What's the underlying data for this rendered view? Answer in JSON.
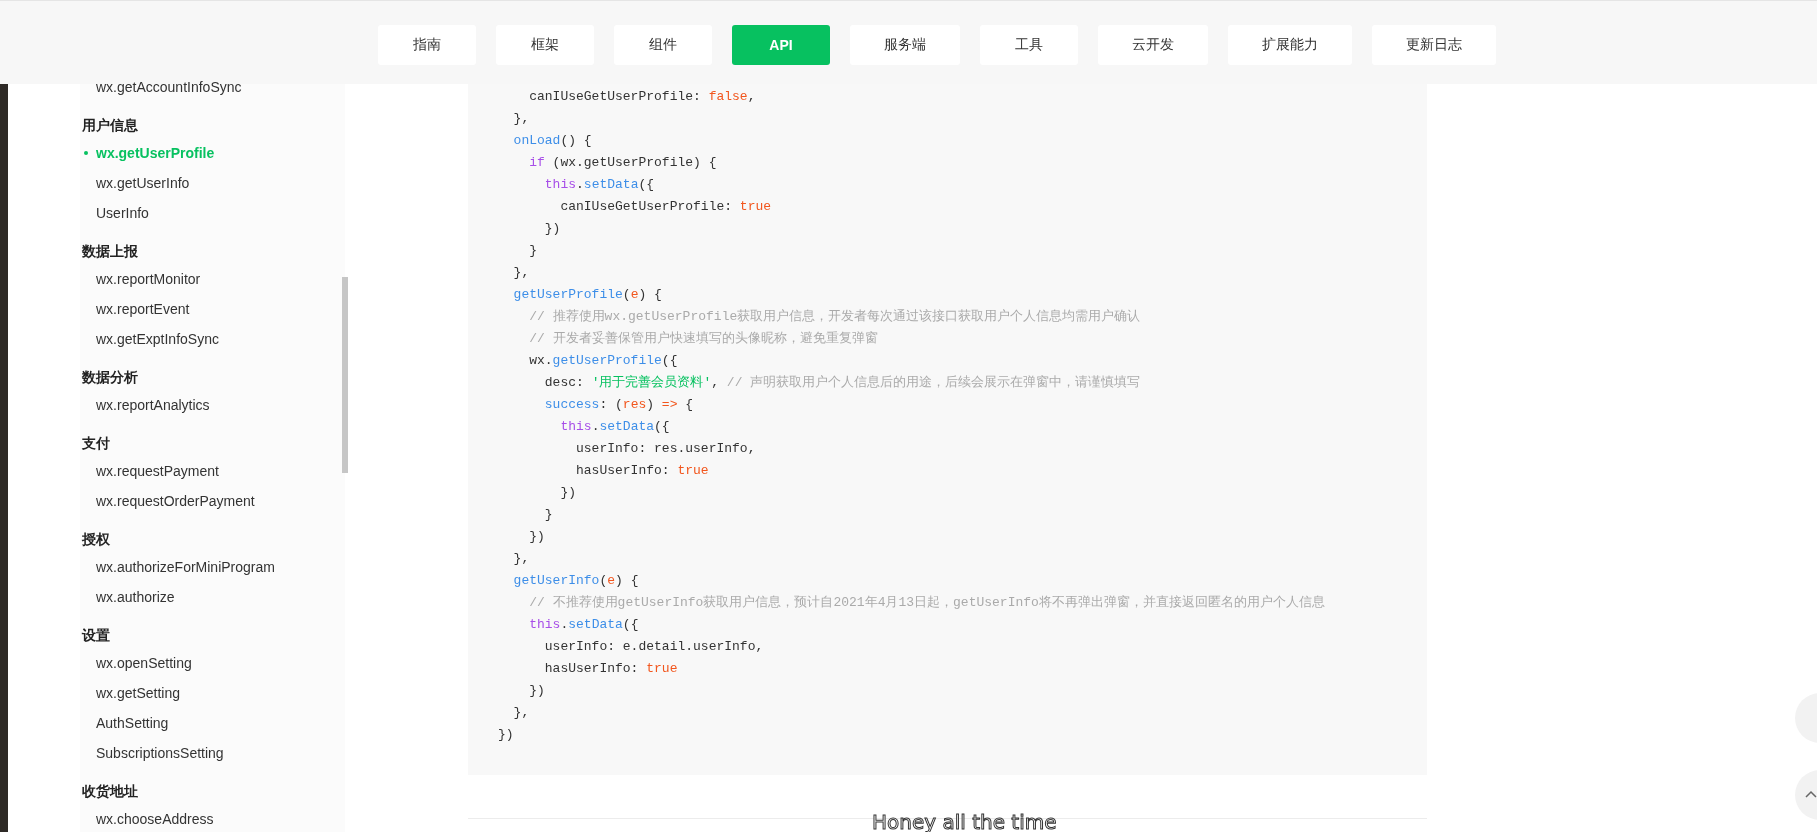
{
  "nav": {
    "tabs": [
      {
        "label": "指南",
        "selected": false
      },
      {
        "label": "框架",
        "selected": false
      },
      {
        "label": "组件",
        "selected": false
      },
      {
        "label": "API",
        "selected": true
      },
      {
        "label": "服务端",
        "selected": false
      },
      {
        "label": "工具",
        "selected": false
      },
      {
        "label": "云开发",
        "selected": false
      },
      {
        "label": "扩展能力",
        "selected": false
      },
      {
        "label": "更新日志",
        "selected": false
      }
    ]
  },
  "sidebar": {
    "groups": [
      {
        "items": [
          {
            "label": "wx.getAccountInfoSync",
            "selected": false
          }
        ]
      },
      {
        "heading": "用户信息",
        "items": [
          {
            "label": "wx.getUserProfile",
            "selected": true
          },
          {
            "label": "wx.getUserInfo",
            "selected": false
          },
          {
            "label": "UserInfo",
            "selected": false
          }
        ]
      },
      {
        "heading": "数据上报",
        "items": [
          {
            "label": "wx.reportMonitor",
            "selected": false
          },
          {
            "label": "wx.reportEvent",
            "selected": false
          },
          {
            "label": "wx.getExptInfoSync",
            "selected": false
          }
        ]
      },
      {
        "heading": "数据分析",
        "items": [
          {
            "label": "wx.reportAnalytics",
            "selected": false
          }
        ]
      },
      {
        "heading": "支付",
        "items": [
          {
            "label": "wx.requestPayment",
            "selected": false
          },
          {
            "label": "wx.requestOrderPayment",
            "selected": false
          }
        ]
      },
      {
        "heading": "授权",
        "items": [
          {
            "label": "wx.authorizeForMiniProgram",
            "selected": false
          },
          {
            "label": "wx.authorize",
            "selected": false
          }
        ]
      },
      {
        "heading": "设置",
        "items": [
          {
            "label": "wx.openSetting",
            "selected": false
          },
          {
            "label": "wx.getSetting",
            "selected": false
          },
          {
            "label": "AuthSetting",
            "selected": false
          },
          {
            "label": "SubscriptionsSetting",
            "selected": false
          }
        ]
      },
      {
        "heading": "收货地址",
        "items": [
          {
            "label": "wx.chooseAddress",
            "selected": false
          }
        ]
      }
    ]
  },
  "code": {
    "lines": [
      [
        {
          "t": "    canIUseGetUserProfile: ",
          "kind": "plain"
        },
        {
          "t": "false",
          "kind": "literal"
        },
        {
          "t": ",",
          "kind": "plain"
        }
      ],
      [
        {
          "t": "  },",
          "kind": "plain"
        }
      ],
      [
        {
          "t": "  onLoad",
          "kind": "function"
        },
        {
          "t": "() {",
          "kind": "plain"
        }
      ],
      [
        {
          "t": "    if",
          "kind": "keyword"
        },
        {
          "t": " (wx.getUserProfile) {",
          "kind": "plain"
        }
      ],
      [
        {
          "t": "      this",
          "kind": "keyword"
        },
        {
          "t": ".",
          "kind": "plain"
        },
        {
          "t": "setData",
          "kind": "function"
        },
        {
          "t": "({",
          "kind": "plain"
        }
      ],
      [
        {
          "t": "        canIUseGetUserProfile: ",
          "kind": "plain"
        },
        {
          "t": "true",
          "kind": "literal"
        }
      ],
      [
        {
          "t": "      })",
          "kind": "plain"
        }
      ],
      [
        {
          "t": "    }",
          "kind": "plain"
        }
      ],
      [
        {
          "t": "  },",
          "kind": "plain"
        }
      ],
      [
        {
          "t": "  getUserProfile",
          "kind": "function"
        },
        {
          "t": "(",
          "kind": "plain"
        },
        {
          "t": "e",
          "kind": "literal"
        },
        {
          "t": ") {",
          "kind": "plain"
        }
      ],
      [
        {
          "t": "    // 推荐使用",
          "kind": "comment"
        },
        {
          "t": "wx.getUserProfile",
          "kind": "comment_code"
        },
        {
          "t": "获取用户信息，开发者每次通过该接口获取用户个人信息均需用户确认",
          "kind": "comment"
        }
      ],
      [
        {
          "t": "    // 开发者妥善保管用户快速填写的头像昵称，避免重复弹窗",
          "kind": "comment"
        }
      ],
      [
        {
          "t": "    wx.",
          "kind": "plain"
        },
        {
          "t": "getUserProfile",
          "kind": "function"
        },
        {
          "t": "({",
          "kind": "plain"
        }
      ],
      [
        {
          "t": "      desc: ",
          "kind": "plain"
        },
        {
          "t": "'用于完善会员资料'",
          "kind": "string"
        },
        {
          "t": ", ",
          "kind": "plain"
        },
        {
          "t": "// 声明获取用户个人信息后的用途，后续会展示在弹窗中，请谨慎填写",
          "kind": "comment"
        }
      ],
      [
        {
          "t": "      success",
          "kind": "function"
        },
        {
          "t": ": (",
          "kind": "plain"
        },
        {
          "t": "res",
          "kind": "literal"
        },
        {
          "t": ") ",
          "kind": "plain"
        },
        {
          "t": "=>",
          "kind": "literal"
        },
        {
          "t": " {",
          "kind": "plain"
        }
      ],
      [
        {
          "t": "        this",
          "kind": "keyword"
        },
        {
          "t": ".",
          "kind": "plain"
        },
        {
          "t": "setData",
          "kind": "function"
        },
        {
          "t": "({",
          "kind": "plain"
        }
      ],
      [
        {
          "t": "          userInfo: res.userInfo,",
          "kind": "plain"
        }
      ],
      [
        {
          "t": "          hasUserInfo: ",
          "kind": "plain"
        },
        {
          "t": "true",
          "kind": "literal"
        }
      ],
      [
        {
          "t": "        })",
          "kind": "plain"
        }
      ],
      [
        {
          "t": "      }",
          "kind": "plain"
        }
      ],
      [
        {
          "t": "    })",
          "kind": "plain"
        }
      ],
      [
        {
          "t": "  },",
          "kind": "plain"
        }
      ],
      [
        {
          "t": "  getUserInfo",
          "kind": "function"
        },
        {
          "t": "(",
          "kind": "plain"
        },
        {
          "t": "e",
          "kind": "literal"
        },
        {
          "t": ") {",
          "kind": "plain"
        }
      ],
      [
        {
          "t": "    // 不推荐使用",
          "kind": "comment"
        },
        {
          "t": "getUserInfo",
          "kind": "comment_code"
        },
        {
          "t": "获取用户信息，预计自2021年4月13日起，",
          "kind": "comment"
        },
        {
          "t": "getUserInfo",
          "kind": "comment_code"
        },
        {
          "t": "将不再弹出弹窗，并直接返回匿名的用户个人信息",
          "kind": "comment"
        }
      ],
      [
        {
          "t": "    this",
          "kind": "keyword"
        },
        {
          "t": ".",
          "kind": "plain"
        },
        {
          "t": "setData",
          "kind": "function"
        },
        {
          "t": "({",
          "kind": "plain"
        }
      ],
      [
        {
          "t": "      userInfo: e.detail.userInfo,",
          "kind": "plain"
        }
      ],
      [
        {
          "t": "      hasUserInfo: ",
          "kind": "plain"
        },
        {
          "t": "true",
          "kind": "literal"
        }
      ],
      [
        {
          "t": "    })",
          "kind": "plain"
        }
      ],
      [
        {
          "t": "  },",
          "kind": "plain"
        }
      ],
      [
        {
          "t": "})",
          "kind": "plain"
        }
      ]
    ]
  },
  "lyrics_overlay": "Honey all the time"
}
